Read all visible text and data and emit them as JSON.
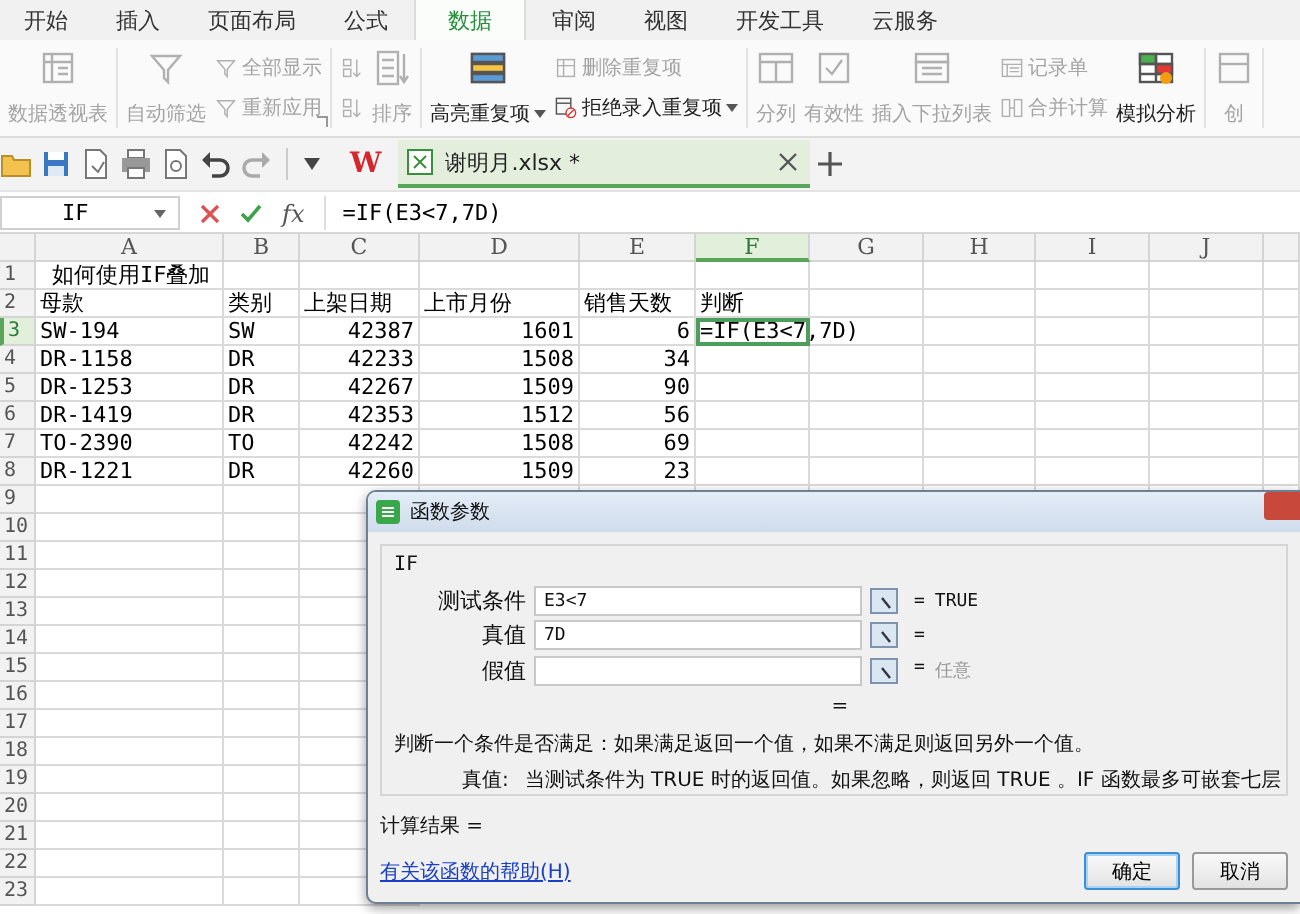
{
  "menu_tabs": [
    {
      "label": "开始",
      "selected": false
    },
    {
      "label": "插入",
      "selected": false
    },
    {
      "label": "页面布局",
      "selected": false
    },
    {
      "label": "公式",
      "selected": false
    },
    {
      "label": "数据",
      "selected": true
    },
    {
      "label": "审阅",
      "selected": false
    },
    {
      "label": "视图",
      "selected": false
    },
    {
      "label": "开发工具",
      "selected": false
    },
    {
      "label": "云服务",
      "selected": false
    }
  ],
  "ribbon": [
    {
      "columns": [
        {
          "kind": "large",
          "items": [
            {
              "label": "数据透视表",
              "disabled": true
            }
          ]
        }
      ]
    },
    {
      "launcher": true,
      "columns": [
        {
          "kind": "large",
          "items": [
            {
              "label": "自动筛选",
              "disabled": true
            }
          ]
        },
        {
          "kind": "stack",
          "items": [
            {
              "label": "全部显示",
              "disabled": true
            },
            {
              "label": "重新应用",
              "disabled": true
            }
          ]
        }
      ]
    },
    {
      "columns": [
        {
          "kind": "stack",
          "items": [
            {
              "disabled": true
            },
            {
              "disabled": true
            }
          ]
        },
        {
          "kind": "large",
          "items": [
            {
              "label": "排序",
              "disabled": true
            }
          ]
        }
      ]
    },
    {
      "columns": [
        {
          "kind": "large",
          "items": [
            {
              "label": "高亮重复项",
              "disabled": false,
              "dropdown": true
            }
          ]
        },
        {
          "kind": "stack",
          "items": [
            {
              "label": "删除重复项",
              "disabled": true
            },
            {
              "label": "拒绝录入重复项",
              "disabled": false,
              "dropdown": true
            }
          ]
        }
      ]
    },
    {
      "columns": [
        {
          "kind": "large",
          "items": [
            {
              "label": "分列",
              "disabled": true
            }
          ]
        },
        {
          "kind": "large",
          "items": [
            {
              "label": "有效性",
              "disabled": true
            }
          ]
        },
        {
          "kind": "large",
          "items": [
            {
              "label": "插入下拉列表",
              "disabled": true
            }
          ]
        },
        {
          "kind": "stack",
          "items": [
            {
              "label": "记录单",
              "disabled": true
            },
            {
              "label": "合并计算",
              "disabled": true
            }
          ]
        },
        {
          "kind": "large",
          "items": [
            {
              "label": "模拟分析",
              "disabled": false
            }
          ]
        }
      ]
    },
    {
      "columns": [
        {
          "kind": "large",
          "items": [
            {
              "label": "创",
              "disabled": true
            }
          ]
        }
      ]
    }
  ],
  "toolbar": {
    "logo": "W",
    "document_tab": {
      "title": "谢明月.xlsx *",
      "selected": true
    }
  },
  "formula_bar": {
    "name_box": "IF",
    "function_label": "fx",
    "formula": "=IF(E3<7,7D)"
  },
  "sheet": {
    "columns": [
      {
        "label": "A",
        "selected": false
      },
      {
        "label": "B",
        "selected": false
      },
      {
        "label": "C",
        "selected": false
      },
      {
        "label": "D",
        "selected": false
      },
      {
        "label": "E",
        "selected": false
      },
      {
        "label": "F",
        "selected": true
      },
      {
        "label": "G",
        "selected": false
      },
      {
        "label": "H",
        "selected": false
      },
      {
        "label": "I",
        "selected": false
      },
      {
        "label": "J",
        "selected": false
      }
    ],
    "rows": [
      {
        "number": "1",
        "selected": false,
        "cells": [
          {
            "text": "如何使用IF叠加",
            "kind": "title",
            "active": false
          }
        ]
      },
      {
        "number": "2",
        "selected": false,
        "cells": [
          {
            "text": "母款",
            "kind": "text",
            "active": false
          },
          {
            "text": "类别",
            "kind": "text",
            "active": false
          },
          {
            "text": "上架日期",
            "kind": "text",
            "active": false
          },
          {
            "text": "上市月份",
            "kind": "text",
            "active": false
          },
          {
            "text": "销售天数",
            "kind": "text",
            "active": false
          },
          {
            "text": "判断",
            "kind": "text",
            "active": false
          }
        ]
      },
      {
        "number": "3",
        "selected": true,
        "cells": [
          {
            "text": "SW-194",
            "kind": "text",
            "active": false
          },
          {
            "text": "SW",
            "kind": "text",
            "active": false
          },
          {
            "text": "42387",
            "kind": "number",
            "active": false
          },
          {
            "text": "1601",
            "kind": "number",
            "active": false
          },
          {
            "text": "6",
            "kind": "number",
            "active": false
          },
          {
            "text": "=IF(E3<7,7D)",
            "kind": "text",
            "active": true
          }
        ]
      },
      {
        "number": "4",
        "selected": false,
        "cells": [
          {
            "text": "DR-1158",
            "kind": "text",
            "active": false
          },
          {
            "text": "DR",
            "kind": "text",
            "active": false
          },
          {
            "text": "42233",
            "kind": "number",
            "active": false
          },
          {
            "text": "1508",
            "kind": "number",
            "active": false
          },
          {
            "text": "34",
            "kind": "number",
            "active": false
          }
        ]
      },
      {
        "number": "5",
        "selected": false,
        "cells": [
          {
            "text": "DR-1253",
            "kind": "text",
            "active": false
          },
          {
            "text": "DR",
            "kind": "text",
            "active": false
          },
          {
            "text": "42267",
            "kind": "number",
            "active": false
          },
          {
            "text": "1509",
            "kind": "number",
            "active": false
          },
          {
            "text": "90",
            "kind": "number",
            "active": false
          }
        ]
      },
      {
        "number": "6",
        "selected": false,
        "cells": [
          {
            "text": "DR-1419",
            "kind": "text",
            "active": false
          },
          {
            "text": "DR",
            "kind": "text",
            "active": false
          },
          {
            "text": "42353",
            "kind": "number",
            "active": false
          },
          {
            "text": "1512",
            "kind": "number",
            "active": false
          },
          {
            "text": "56",
            "kind": "number",
            "active": false
          }
        ]
      },
      {
        "number": "7",
        "selected": false,
        "cells": [
          {
            "text": "TO-2390",
            "kind": "text",
            "active": false
          },
          {
            "text": "TO",
            "kind": "text",
            "active": false
          },
          {
            "text": "42242",
            "kind": "number",
            "active": false
          },
          {
            "text": "1508",
            "kind": "number",
            "active": false
          },
          {
            "text": "69",
            "kind": "number",
            "active": false
          }
        ]
      },
      {
        "number": "8",
        "selected": false,
        "cells": [
          {
            "text": "DR-1221",
            "kind": "text",
            "active": false
          },
          {
            "text": "DR",
            "kind": "text",
            "active": false
          },
          {
            "text": "42260",
            "kind": "number",
            "active": false
          },
          {
            "text": "1509",
            "kind": "number",
            "active": false
          },
          {
            "text": "23",
            "kind": "number",
            "active": false
          }
        ]
      },
      {
        "number": "9",
        "selected": false
      },
      {
        "number": "10",
        "selected": false
      },
      {
        "number": "11",
        "selected": false
      },
      {
        "number": "12",
        "selected": false
      },
      {
        "number": "13",
        "selected": false
      },
      {
        "number": "14",
        "selected": false
      },
      {
        "number": "15",
        "selected": false
      },
      {
        "number": "16",
        "selected": false
      },
      {
        "number": "17",
        "selected": false
      },
      {
        "number": "18",
        "selected": false
      },
      {
        "number": "19",
        "selected": false
      },
      {
        "number": "20",
        "selected": false
      },
      {
        "number": "21",
        "selected": false
      },
      {
        "number": "22",
        "selected": false
      },
      {
        "number": "23",
        "selected": false
      }
    ]
  },
  "dialog": {
    "title": "函数参数",
    "function_name": "IF",
    "params": [
      {
        "label": "测试条件",
        "value": "E3<7",
        "equals": "=",
        "result": "TRUE",
        "result_greyed": false
      },
      {
        "label": "真值",
        "value": "7D",
        "equals": "="
      },
      {
        "label": "假值",
        "equals": "=",
        "result": "任意",
        "result_greyed": true
      }
    ],
    "formula_result": "=",
    "description": "判断一个条件是否满足：如果满足返回一个值，如果不满足则返回另外一个值。",
    "argument_help": {
      "label": "真值:",
      "text": "当测试条件为 TRUE 时的返回值。如果忽略，则返回 TRUE 。IF 函数最多可嵌套七层"
    },
    "calc_result": "计算结果 =",
    "help_link": "有关该函数的帮助(H)",
    "buttons": [
      {
        "label": "确定",
        "focused": true
      },
      {
        "label": "取消",
        "focused": false
      }
    ]
  }
}
